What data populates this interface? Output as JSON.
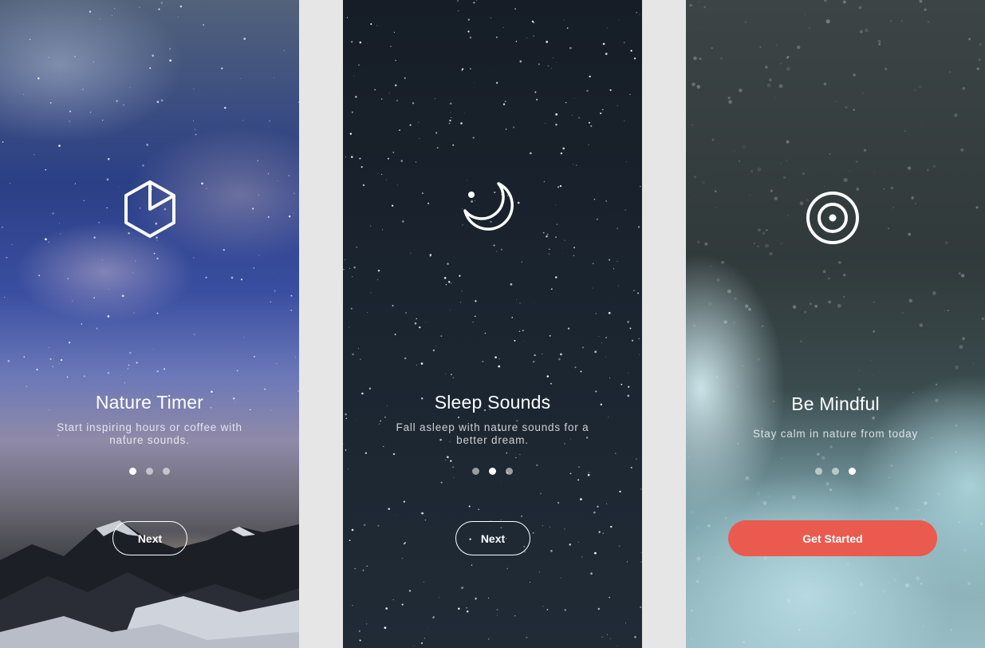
{
  "screens": [
    {
      "icon": "hexagon-pie-icon",
      "title": "Nature Timer",
      "subtitle": "Start inspiring hours or coffee with nature sounds.",
      "active_dot": 1,
      "button_label": "Next"
    },
    {
      "icon": "moon-icon",
      "title": "Sleep Sounds",
      "subtitle": "Fall asleep with nature sounds for a better dream.",
      "active_dot": 2,
      "button_label": "Next"
    },
    {
      "icon": "target-icon",
      "title": "Be Mindful",
      "subtitle": "Stay calm in nature from today",
      "active_dot": 3,
      "button_label": "Get Started"
    }
  ],
  "colors": {
    "accent": "#ea5a4f",
    "background": "#e6e6e6"
  }
}
